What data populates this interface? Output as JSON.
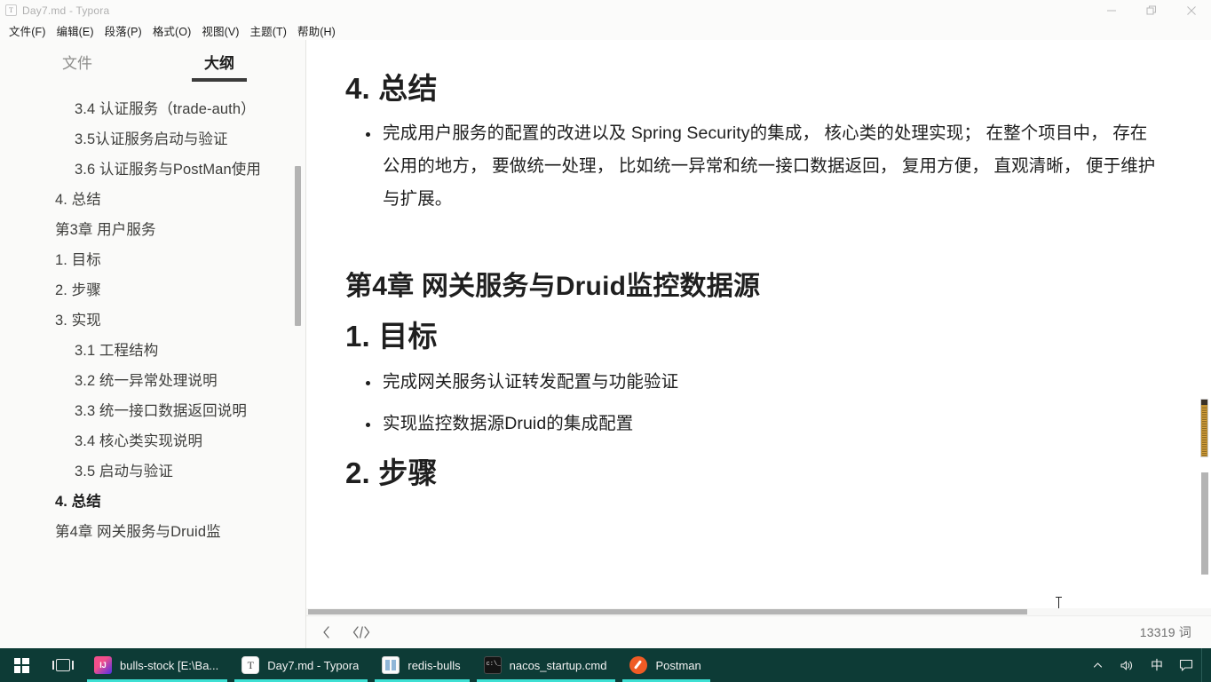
{
  "window": {
    "title": "Day7.md - Typora",
    "app_icon": "typora-document-icon",
    "controls": {
      "minimize": "minimize-icon",
      "restore": "restore-icon",
      "close": "close-icon"
    }
  },
  "menu": {
    "items": [
      {
        "label": "文件(F)",
        "name": "menu-file"
      },
      {
        "label": "编辑(E)",
        "name": "menu-edit"
      },
      {
        "label": "段落(P)",
        "name": "menu-paragraph"
      },
      {
        "label": "格式(O)",
        "name": "menu-format"
      },
      {
        "label": "视图(V)",
        "name": "menu-view"
      },
      {
        "label": "主题(T)",
        "name": "menu-theme"
      },
      {
        "label": "帮助(H)",
        "name": "menu-help"
      }
    ]
  },
  "sidebar": {
    "tabs": [
      {
        "label": "文件",
        "active": false
      },
      {
        "label": "大纲",
        "active": true
      }
    ],
    "outline": [
      {
        "label": "3.4 认证服务（trade-auth）",
        "level": 2,
        "active": false
      },
      {
        "label": "3.5认证服务启动与验证",
        "level": 2,
        "active": false
      },
      {
        "label": "3.6 认证服务与PostMan使用",
        "level": 2,
        "active": false
      },
      {
        "label": "4. 总结",
        "level": 1,
        "active": false
      },
      {
        "label": "第3章 用户服务",
        "level": 1,
        "active": false
      },
      {
        "label": "1. 目标",
        "level": 1,
        "active": false
      },
      {
        "label": "2. 步骤",
        "level": 1,
        "active": false
      },
      {
        "label": "3. 实现",
        "level": 1,
        "active": false
      },
      {
        "label": "3.1 工程结构",
        "level": 2,
        "active": false
      },
      {
        "label": "3.2 统一异常处理说明",
        "level": 2,
        "active": false
      },
      {
        "label": "3.3 统一接口数据返回说明",
        "level": 2,
        "active": false
      },
      {
        "label": "3.4 核心类实现说明",
        "level": 2,
        "active": false
      },
      {
        "label": "3.5 启动与验证",
        "level": 2,
        "active": false
      },
      {
        "label": "4. 总结",
        "level": 1,
        "active": true
      },
      {
        "label": "第4章 网关服务与Druid监",
        "level": 1,
        "active": false
      }
    ]
  },
  "editor": {
    "blocks": [
      {
        "type": "h2",
        "text": "4. 总结"
      },
      {
        "type": "ul",
        "items": [
          "完成用户服务的配置的改进以及 Spring Security的集成， 核心类的处理实现； 在整个项目中， 存在公用的地方， 要做统一处理， 比如统一异常和统一接口数据返回， 复用方便， 直观清晰， 便于维护与扩展。"
        ]
      },
      {
        "type": "h1",
        "text": "第4章 网关服务与Druid监控数据源"
      },
      {
        "type": "h2",
        "text": "1. 目标"
      },
      {
        "type": "ul",
        "items": [
          "完成网关服务认证转发配置与功能验证",
          "实现监控数据源Druid的集成配置"
        ]
      },
      {
        "type": "h2",
        "text": "2. 步骤"
      }
    ]
  },
  "status_bar": {
    "back_icon": "chevron-left-icon",
    "source_code_icon": "source-code-icon",
    "word_count": "13319 词"
  },
  "taskbar": {
    "start": "windows-start-icon",
    "task_view": "task-view-icon",
    "apps": [
      {
        "label": "bulls-stock [E:\\Ba...",
        "icon": "intellij-idea-icon",
        "icon_class": "idea",
        "name": "taskbar-app-intellij"
      },
      {
        "label": "Day7.md - Typora",
        "icon": "typora-icon",
        "icon_class": "typora",
        "name": "taskbar-app-typora"
      },
      {
        "label": "redis-bulls",
        "icon": "redis-manager-icon",
        "icon_class": "redis",
        "name": "taskbar-app-redis"
      },
      {
        "label": "nacos_startup.cmd",
        "icon": "command-prompt-icon",
        "icon_class": "cmd",
        "name": "taskbar-app-nacos"
      },
      {
        "label": "Postman",
        "icon": "postman-icon",
        "icon_class": "postman",
        "name": "taskbar-app-postman"
      }
    ],
    "tray": [
      {
        "glyph": "⌃",
        "name": "show-hidden-icons-icon"
      },
      {
        "glyph": "🔊",
        "name": "volume-icon"
      },
      {
        "glyph": "中",
        "name": "ime-chinese-icon"
      },
      {
        "glyph": "▭",
        "name": "action-center-icon"
      }
    ]
  },
  "colors": {
    "taskbar_bg": "#0d3b36",
    "taskbar_indicator": "#3ee0d3",
    "scrollbar_accent": "#b98b2e",
    "tab_underline": "#3b3b3b"
  }
}
